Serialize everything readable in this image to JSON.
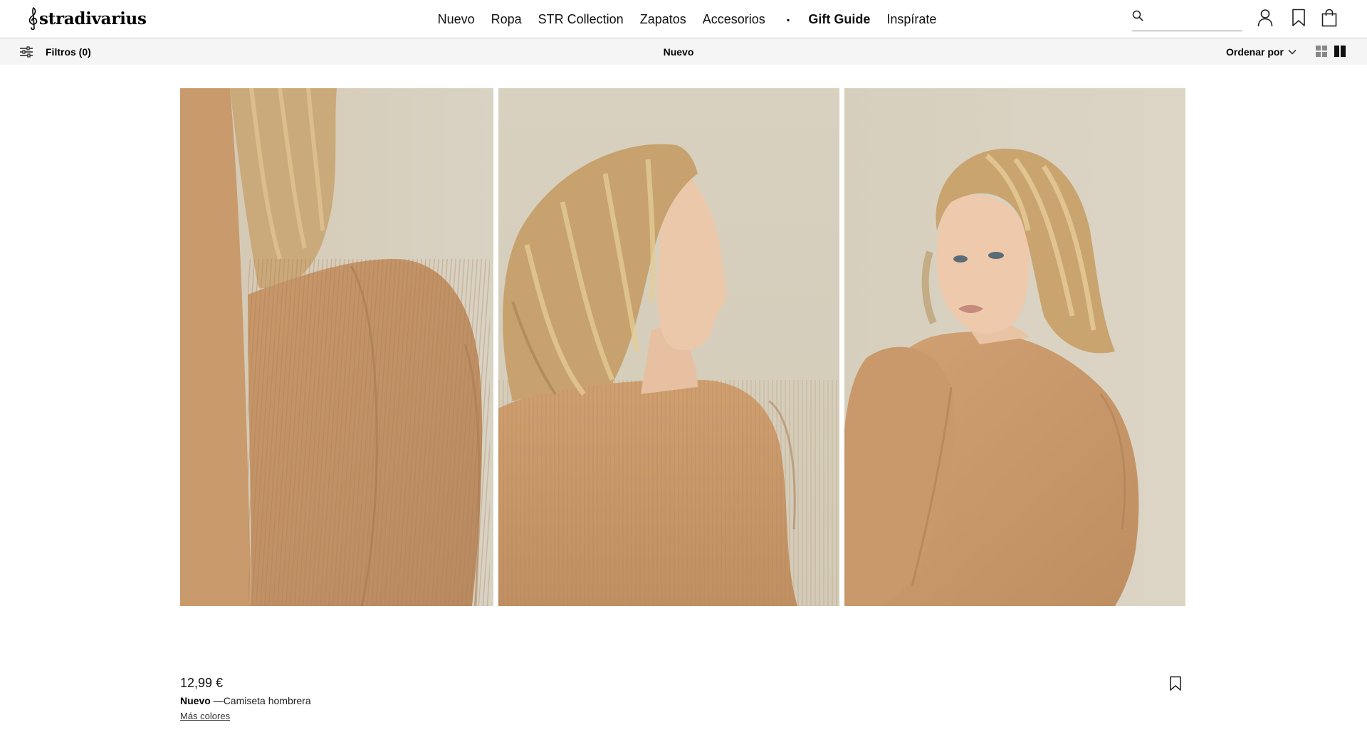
{
  "brand": {
    "name": "stradivarius"
  },
  "nav": {
    "items": [
      "Nuevo",
      "Ropa",
      "STR Collection",
      "Zapatos",
      "Accesorios"
    ],
    "separator": ".",
    "featured": [
      "Gift Guide",
      "Inspírate"
    ]
  },
  "search": {
    "value": "",
    "placeholder": ""
  },
  "subbar": {
    "filters_label": "Filtros (0)",
    "title": "Nuevo",
    "sort_label": "Ordenar por"
  },
  "product": {
    "price": "12,99 €",
    "badge": "Nuevo",
    "name": "—Camiseta hombrera",
    "more_colors": "Más colores",
    "images": [
      "shoulder-detail",
      "profile-side",
      "back-over-shoulder"
    ]
  },
  "colors": {
    "background": "#ffffff",
    "subbar": "#f5f5f5",
    "garment": "#c99a6e",
    "backdrop": "#d6cebd"
  }
}
